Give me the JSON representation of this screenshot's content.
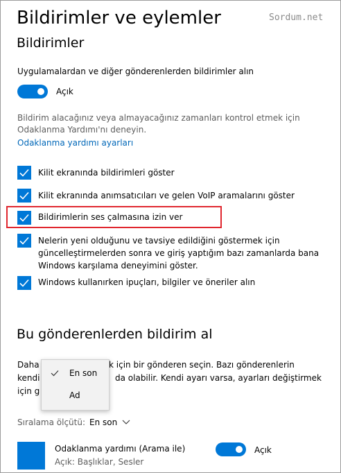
{
  "header": {
    "title": "Bildirimler ve eylemler",
    "watermark": "Sordum.net"
  },
  "notifications": {
    "section_title": "Bildirimler",
    "get_notifications_label": "Uygulamalardan ve diğer gönderenlerden bildirimler alın",
    "toggle_state": "Açık",
    "focus_info_line1": "Bildirim alacağınız veya almayacağınız zamanları kontrol etmek için",
    "focus_info_line2": "Odaklanma Yardımı'nı deneyin.",
    "focus_settings_link": "Odaklanma yardımı ayarları",
    "checkboxes": [
      {
        "lines": [
          "Kilit ekranında bildirimleri göster"
        ],
        "checked": true
      },
      {
        "lines": [
          "Kilit ekranında anımsatıcıları ve gelen VoIP aramalarını göster"
        ],
        "checked": true
      },
      {
        "lines": [
          "Bildirimlerin ses çalmasına izin ver"
        ],
        "checked": true
      },
      {
        "lines": [
          "Nelerin yeni olduğunu ve tavsiye edildiğini göstermek için",
          "güncelleştirmelerden sonra ve giriş yaptığım bazı zamanlarda bana",
          "Windows karşılama deneyimini göster."
        ],
        "checked": true
      },
      {
        "lines": [
          "Windows kullanırken ipuçları, bilgiler ve öneriler alın"
        ],
        "checked": true
      }
    ]
  },
  "senders": {
    "section_title": "Bu gönderenlerden bildirim al",
    "desc_line1_left": "Daha",
    "desc_line1_right": "k için bir gönderen seçin. Bazı gönderenlerin",
    "desc_line2_left": "kendi",
    "desc_line2_right": "da olabilir. Kendi ayarı varsa, ayarları değiştirmek",
    "desc_line3_left": "için g",
    "sort_label": "Sıralama ölçütü:",
    "sort_value": "En son",
    "sort_options": [
      "En son",
      "Ad"
    ],
    "selected_sort": "En son",
    "apps": [
      {
        "name": "Odaklanma yardımı (Arama ile)",
        "subtitle": "Açık: Başlıklar, Sesler",
        "toggle_state": "Açık"
      }
    ]
  },
  "colors": {
    "accent": "#0078d7",
    "link": "#0067b8",
    "highlight_border": "#e0262e",
    "muted_text": "#5d5d5d"
  }
}
